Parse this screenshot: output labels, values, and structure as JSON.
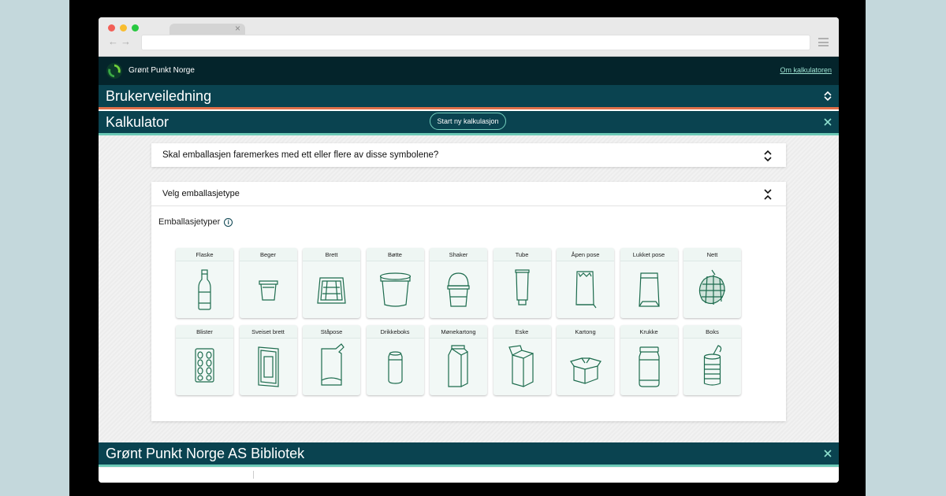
{
  "header": {
    "brand": "Grønt Punkt Norge",
    "about_link": "Om kalkulatoren"
  },
  "sections": {
    "guide_title": "Brukerveiledning",
    "calculator_title": "Kalkulator",
    "new_calc_button": "Start ny kalkulasjon",
    "library_title": "Grønt Punkt Norge AS Bibliotek"
  },
  "panels": {
    "question": "Skal emballasjen faremerkes med ett eller flere av disse symbolene?",
    "select_type": "Velg emballasjetype",
    "types_label": "Emballasjetyper",
    "info_glyph": "i"
  },
  "packaging_types": [
    "Flaske",
    "Beger",
    "Brett",
    "Bøtte",
    "Shaker",
    "Tube",
    "Åpen pose",
    "Lukket pose",
    "Nett",
    "Blister",
    "Sveiset brett",
    "Ståpose",
    "Drikkeboks",
    "Mønekartong",
    "Eske",
    "Kartong",
    "Krukke",
    "Boks"
  ],
  "colors": {
    "dark_bar": "#04242b",
    "section_bar": "#0a4350",
    "accent_orange": "#e0704a",
    "accent_teal": "#6cc9b6",
    "icon_green": "#1c6b4d"
  }
}
